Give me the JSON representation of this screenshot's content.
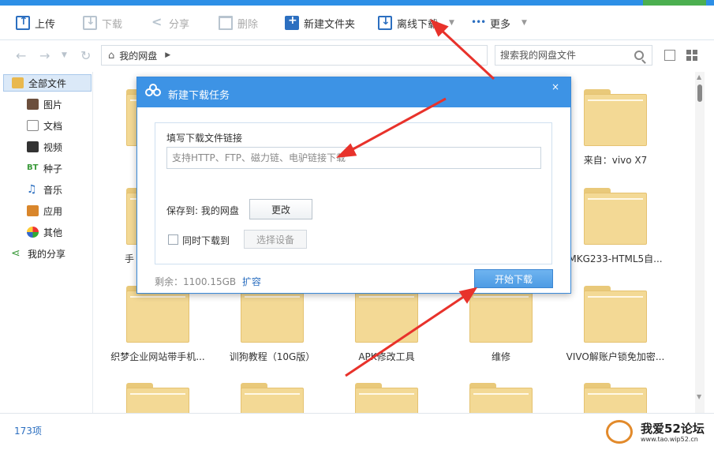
{
  "toolbar": {
    "upload": "上传",
    "download": "下载",
    "share": "分享",
    "delete": "删除",
    "new_folder": "新建文件夹",
    "offline_download": "离线下载",
    "more": "更多"
  },
  "nav": {
    "breadcrumb": "我的网盘",
    "search_placeholder": "搜索我的网盘文件"
  },
  "sidebar": {
    "items": [
      {
        "label": "全部文件",
        "icon": "folder-icon"
      },
      {
        "label": "图片",
        "icon": "picture-icon"
      },
      {
        "label": "文档",
        "icon": "document-icon"
      },
      {
        "label": "视频",
        "icon": "video-icon"
      },
      {
        "label": "种子",
        "icon": "bt-icon"
      },
      {
        "label": "音乐",
        "icon": "music-icon"
      },
      {
        "label": "应用",
        "icon": "app-icon"
      },
      {
        "label": "其他",
        "icon": "other-icon"
      },
      {
        "label": "我的分享",
        "icon": "share-icon"
      }
    ]
  },
  "files": {
    "row1_right": "来自：vivo X7",
    "row2_left_partial": "手",
    "row2_right": "MKG233-HTML5自...",
    "row3": [
      "织梦企业网站带手机...",
      "训狗教程（10G版）",
      "APK修改工具",
      "维修",
      "VIVO解账户锁免加密..."
    ]
  },
  "status": {
    "count": "173项"
  },
  "watermark": {
    "title": "我爱52论坛",
    "url": "www.tao.wip52.cn"
  },
  "dialog": {
    "title": "新建下载任务",
    "close": "×",
    "link_label": "填写下载文件链接",
    "link_placeholder": "支持HTTP、FTP、磁力链、电驴链接下载",
    "save_to": "保存到: 我的网盘",
    "change": "更改",
    "sync_label": "同时下载到",
    "select_device": "选择设备",
    "remaining": "剩余：1100.15GB",
    "expand": "扩容",
    "start": "开始下载"
  },
  "colors": {
    "accent": "#3d93e5",
    "folder": "#f3d995",
    "annotation_arrow": "#e8322b"
  }
}
